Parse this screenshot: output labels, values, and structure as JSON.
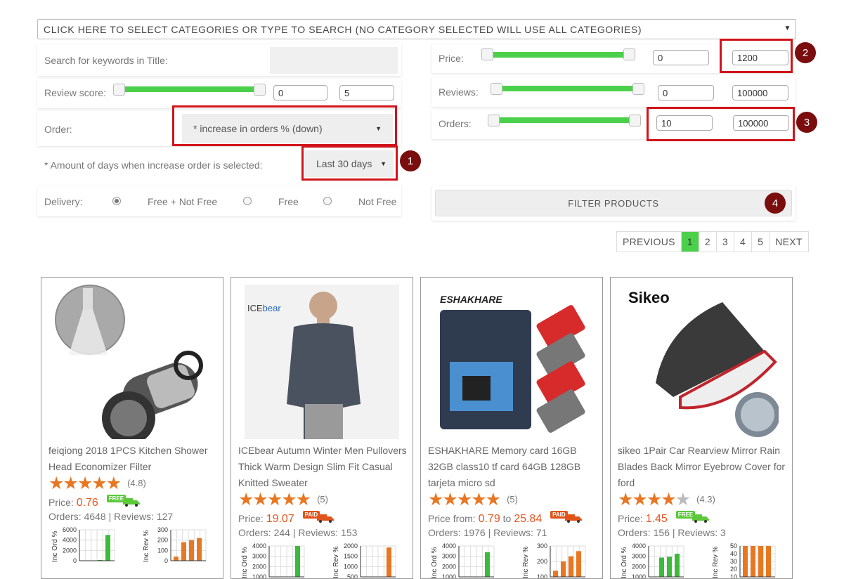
{
  "category_select": {
    "text": "CLICK HERE TO SELECT CATEGORIES OR TYPE TO SEARCH (NO CATEGORY SELECTED WILL USE ALL CATEGORIES)"
  },
  "filters": {
    "keywords_label": "Search for keywords in Title:",
    "keywords_value": "",
    "review_label": "Review score:",
    "review_min": "0",
    "review_max": "5",
    "order_label": "Order:",
    "order_value": "* increase in orders % (down)",
    "days_label": "* Amount of days when increase order is selected:",
    "days_value": "Last 30 days",
    "delivery_label": "Delivery:",
    "delivery_options": [
      "Free + Not Free",
      "Free",
      "Not Free"
    ],
    "delivery_selected": "Free + Not Free",
    "price_label": "Price:",
    "price_min": "0",
    "price_max": "1200",
    "reviews_label": "Reviews:",
    "reviews_min": "0",
    "reviews_max": "100000",
    "orders_label": "Orders:",
    "orders_min": "10",
    "orders_max": "100000",
    "filter_button": "FILTER PRODUCTS"
  },
  "markers": [
    "1",
    "2",
    "3",
    "4"
  ],
  "pagination": {
    "prev": "PREVIOUS",
    "pages": [
      "1",
      "2",
      "3",
      "4",
      "5"
    ],
    "current": "1",
    "next": "NEXT"
  },
  "colors": {
    "slider": "#4ad04a",
    "highlight": "#d0141a",
    "marker": "#7a0d0d",
    "price": "#e8541e",
    "star": "#e87722"
  },
  "products": [
    {
      "title": "feiqiong 2018 1PCS Kitchen Shower Head Economizer Filter",
      "rating": 4.8,
      "rating_text": "(4.8)",
      "price_label": "Price:",
      "price": "0.76",
      "price_to": "",
      "shipping": "FREE",
      "orders_label": "Orders:",
      "orders": "4648",
      "reviews_label": "Reviews:",
      "reviews": "127",
      "chart1": {
        "ylabel": "Inc Ord %",
        "ticks": [
          "6000",
          "4000",
          "2000",
          "0"
        ],
        "ymax": 6000,
        "values": [
          0,
          0,
          150,
          5000
        ],
        "color": "#3cba3c"
      },
      "chart2": {
        "ylabel": "Inc Rev %",
        "ticks": [
          "300",
          "200",
          "100",
          "0"
        ],
        "ymax": 300,
        "values": [
          40,
          180,
          200,
          220
        ],
        "color": "#e87722"
      }
    },
    {
      "title": "ICEbear Autumn Winter Men Pullovers Thick Warm Design Slim Fit Casual Knitted Sweater",
      "rating": 5,
      "rating_text": "(5)",
      "price_label": "Price:",
      "price": "19.07",
      "price_to": "",
      "shipping": "PAID",
      "orders_label": "Orders:",
      "orders": "244",
      "reviews_label": "Reviews:",
      "reviews": "153",
      "chart1": {
        "ylabel": "Inc Ord %",
        "ticks": [
          "4000",
          "3000",
          "2000",
          "1000"
        ],
        "ymax": 4000,
        "values": [
          0,
          0,
          0,
          4000
        ],
        "color": "#3cba3c"
      },
      "chart2": {
        "ylabel": "Inc Rev %",
        "ticks": [
          "2000",
          "1500",
          "1000",
          "500"
        ],
        "ymax": 2000,
        "values": [
          0,
          0,
          0,
          1900
        ],
        "color": "#e87722"
      }
    },
    {
      "title": "ESHAKHARE Memory card 16GB 32GB class10 tf card 64GB 128GB tarjeta micro sd",
      "rating": 5,
      "rating_text": "(5)",
      "price_label": "Price from:",
      "price": "0.79",
      "price_to": "25.84",
      "shipping": "PAID",
      "orders_label": "Orders:",
      "orders": "1976",
      "reviews_label": "Reviews:",
      "reviews": "71",
      "chart1": {
        "ylabel": "Inc Ord %",
        "ticks": [
          "4000",
          "3000",
          "2000",
          "1000"
        ],
        "ymax": 4000,
        "values": [
          0,
          0,
          0,
          3200
        ],
        "color": "#3cba3c"
      },
      "chart2": {
        "ylabel": "Inc Rev %",
        "ticks": [
          "300",
          "200",
          "100"
        ],
        "ymax": 300,
        "values": [
          60,
          150,
          200,
          250
        ],
        "color": "#e87722"
      }
    },
    {
      "title": "sikeo 1Pair Car Rearview Mirror Rain Blades Back Mirror Eyebrow Cover for ford",
      "rating": 4.3,
      "rating_text": "(4.3)",
      "price_label": "Price:",
      "price": "1.45",
      "price_to": "",
      "shipping": "FREE",
      "orders_label": "Orders:",
      "orders": "156",
      "reviews_label": "Reviews:",
      "reviews": "3",
      "chart1": {
        "ylabel": "Inc Ord %",
        "ticks": [
          "4000",
          "3000",
          "2000",
          "1000"
        ],
        "ymax": 4000,
        "values": [
          0,
          2500,
          2600,
          3000
        ],
        "color": "#3cba3c"
      },
      "chart2": {
        "ylabel": "Inc Rev %",
        "ticks": [
          "50",
          "40",
          "30",
          "20",
          "10"
        ],
        "ymax": 50,
        "values": [
          50,
          50,
          50,
          50
        ],
        "color": "#e87722"
      }
    }
  ]
}
